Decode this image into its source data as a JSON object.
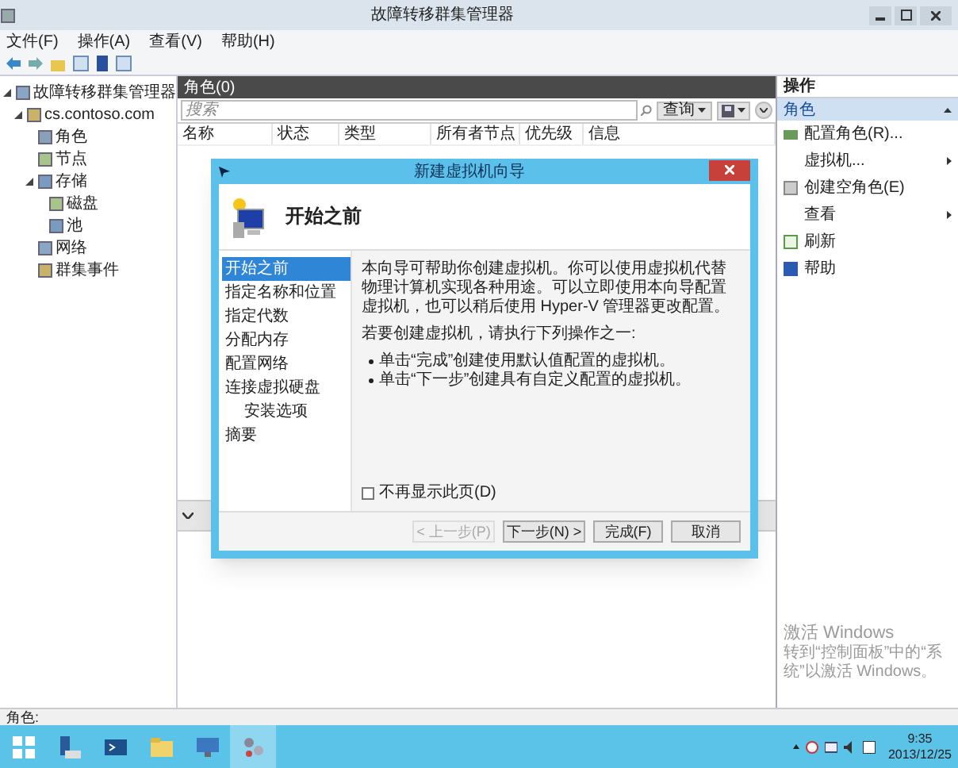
{
  "window": {
    "title": "故障转移群集管理器"
  },
  "menu": [
    "文件(F)",
    "操作(A)",
    "查看(V)",
    "帮助(H)"
  ],
  "tree": [
    {
      "label": "故障转移群集管理器",
      "expanded": true,
      "children": [
        {
          "label": "cs.contoso.com",
          "expanded": true,
          "children": [
            {
              "label": "角色"
            },
            {
              "label": "节点"
            },
            {
              "label": "存储",
              "expanded": true,
              "children": [
                {
                  "label": "磁盘"
                },
                {
                  "label": "池"
                }
              ]
            },
            {
              "label": "网络"
            },
            {
              "label": "群集事件"
            }
          ]
        }
      ]
    }
  ],
  "center": {
    "title": "角色(0)",
    "search": {
      "placeholder": "搜索"
    },
    "query_button": "查询",
    "columns": [
      "名称",
      "状态",
      "类型",
      "所有者节点",
      "优先级",
      "信息"
    ]
  },
  "actions": {
    "title": "操作",
    "section": {
      "label": "角色",
      "expanded": true
    },
    "items": [
      {
        "label": "配置角色(R)...",
        "submenu": false
      },
      {
        "label": "虚拟机...",
        "submenu": true
      },
      {
        "label": "创建空角色(E)",
        "submenu": false
      },
      {
        "label": "查看",
        "submenu": true
      },
      {
        "label": "刷新",
        "submenu": false
      },
      {
        "label": "帮助",
        "submenu": false
      }
    ]
  },
  "dialog": {
    "title": "新建虚拟机向导",
    "heading": "开始之前",
    "steps": [
      {
        "label": "开始之前",
        "selected": true
      },
      {
        "label": "指定名称和位置",
        "selected": false
      },
      {
        "label": "指定代数",
        "selected": false
      },
      {
        "label": "分配内存",
        "selected": false
      },
      {
        "label": "配置网络",
        "selected": false
      },
      {
        "label": "连接虚拟硬盘",
        "selected": false,
        "children": [
          {
            "label": "安装选项",
            "selected": false
          }
        ]
      },
      {
        "label": "摘要",
        "selected": false
      }
    ],
    "paragraphs": [
      "本向导可帮助你创建虚拟机。你可以使用虚拟机代替物理计算机实现各种用途。可以立即使用本向导配置虚拟机，也可以稍后使用 Hyper-V 管理器更改配置。",
      "若要创建虚拟机，请执行下列操作之一:"
    ],
    "bullets": [
      "单击“完成”创建使用默认值配置的虚拟机。",
      "单击“下一步”创建具有自定义配置的虚拟机。"
    ],
    "checkbox": {
      "label": "不再显示此页(D)",
      "checked": false
    },
    "buttons": [
      {
        "label": "< 上一步(P)",
        "disabled": true
      },
      {
        "label": "下一步(N) >",
        "disabled": false
      },
      {
        "label": "完成(F)",
        "disabled": false
      },
      {
        "label": "取消",
        "disabled": false
      }
    ]
  },
  "status_bar": "角色:",
  "activation": {
    "title": "激活 Windows",
    "text": "转到“控制面板”中的“系统”以激活 Windows。"
  },
  "taskbar": {
    "time": "9:35",
    "date": "2013/12/25"
  }
}
